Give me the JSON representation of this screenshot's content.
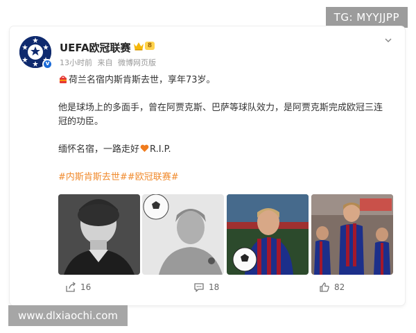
{
  "watermark_top": "TG: MYYJJPP",
  "watermark_bottom": "www.dlxiaochi.com",
  "post": {
    "author": "UEFA欧冠联赛",
    "level": "8",
    "time": "13小时前",
    "source_prefix": "来自",
    "source": "微博网页版",
    "line1": "荷兰名宿内斯肯斯去世，享年73岁。",
    "line2": "他是球场上的多面手，曾在阿贾克斯、巴萨等球队效力，是阿贾克斯完成欧冠三连冠的功臣。",
    "line3_a": "缅怀名宿，一路走好",
    "line3_b": "R.I.P.",
    "hashtag1": "#内斯肯斯去世#",
    "hashtag2": "#欧冠联赛#"
  },
  "actions": {
    "repost_count": "16",
    "comment_count": "18",
    "like_count": "82"
  },
  "icons": [
    "verified-icon",
    "crown-icon",
    "chevron-down-icon",
    "pin-icon",
    "heart-icon",
    "repost-icon",
    "comment-icon",
    "like-icon"
  ],
  "colors": {
    "hashtag": "#f08a2c",
    "verified": "#1b6bd8"
  }
}
